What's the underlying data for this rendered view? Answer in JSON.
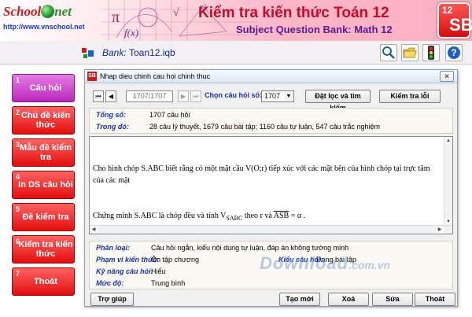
{
  "header": {
    "logo_prefix": "School",
    "logo_suffix": "net",
    "url": "http://www.vnschool.net",
    "title": "Kiểm tra kiến thức Toán 12",
    "subtitle": "Subject Question Bank: Math 12",
    "badge_number": "12",
    "badge_letters": "SB"
  },
  "toolbar": {
    "bank_label": "Bank:",
    "bank_value": "Toan12.iqb",
    "icons": [
      "search-icon",
      "folder-icon",
      "traffic-light-icon",
      "help-icon"
    ],
    "help_glyph": "?"
  },
  "nav": {
    "items": [
      {
        "num": "1",
        "label": "Câu hỏi"
      },
      {
        "num": "2",
        "label": "Chủ đề kiến thức"
      },
      {
        "num": "3",
        "label": "Mẫu đề kiểm tra"
      },
      {
        "num": "4",
        "label": "In DS câu hỏi"
      },
      {
        "num": "5",
        "label": "Đề kiểm tra"
      },
      {
        "num": "6",
        "label": "Kiểm tra kiến thức"
      },
      {
        "num": "7",
        "label": "Thoát"
      }
    ]
  },
  "dialog": {
    "title": "Nhap dieu chinh cau hoi chinh thuc",
    "close_glyph": "✕",
    "position": "1707/1707",
    "choose_label": "Chọn câu hỏi số:",
    "selected": "1707",
    "btn_filter": "Đặt lọc và tìm kiếm",
    "btn_check": "Kiểm tra lỗi",
    "total_label": "Tổng số:",
    "total_value": "1707 câu hỏi",
    "within_label": "Trong đó:",
    "within_value": "28 câu lý thuyết, 1679 câu bài tập; 1160 câu tự luận, 547 câu trắc nghiệm",
    "question_line1": "Cho hình chóp S.ABC biết rằng có một mặt cầu V(O;r) tiếp xúc với các mặt bên của hình chóp tại trực tâm của các mặt",
    "question_line2": "Chứng minh S.ABC là chóp đều và tính V",
    "question_sub": "SABC",
    "question_line2b": " theo r và ",
    "question_angle": "ASB",
    "question_end": " = α .",
    "classify_label": "Phân loại:",
    "classify_value": "Câu hỏi ngắn, kiểu nội dung tự luận, đáp án không tường minh",
    "scope_label": "Phạm vi kiến thức:",
    "scope_value": "Ôn tập chương",
    "type_label": "Kiểu câu hỏi:",
    "type_value": "Dạng bài tập",
    "skill_label": "Kỹ năng câu hỏi:",
    "skill_value": "Hiểu",
    "level_label": "Mức độ:",
    "level_value": "Trung bình",
    "btn_help": "Trợ giúp",
    "btn_new": "Tạo mới",
    "btn_delete": "Xoá",
    "btn_edit": "Sửa",
    "btn_exit": "Thoát"
  },
  "watermark": {
    "main": "Download",
    "domain": ".com.vn"
  }
}
